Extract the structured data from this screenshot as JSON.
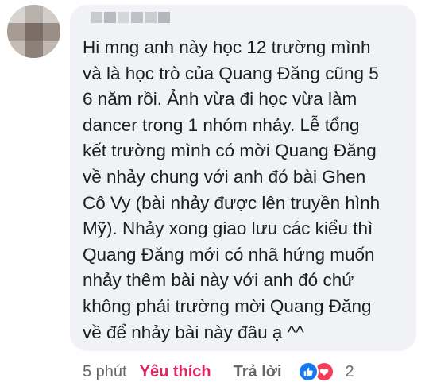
{
  "comment": {
    "text": "Hi mng anh này học 12 trường mình\nvà là học trò của Quang Đăng cũng 5\n6 năm rồi. Ảnh vừa đi học vừa làm\ndancer trong 1 nhóm nhảy. Lễ tổng\nkết trường mình có mời Quang Đăng\nvề nhảy chung với anh đó bài Ghen\nCô Vy (bài nhảy được lên truyền hình\nMỹ). Nhảy xong giao lưu các kiểu thì\nQuang Đăng mới có nhã hứng muốn\nnhảy thêm bài này với anh đó chứ\nkhông phải trường mời Quang Đăng\nvề để nhảy bài này đâu ạ ^^"
  },
  "actions": {
    "time": "5 phút",
    "like_label": "Yêu thích",
    "reply_label": "Trả lời",
    "reaction_count": "2",
    "like_color": "#e0245e"
  },
  "reactions": [
    "like-icon",
    "love-icon"
  ]
}
